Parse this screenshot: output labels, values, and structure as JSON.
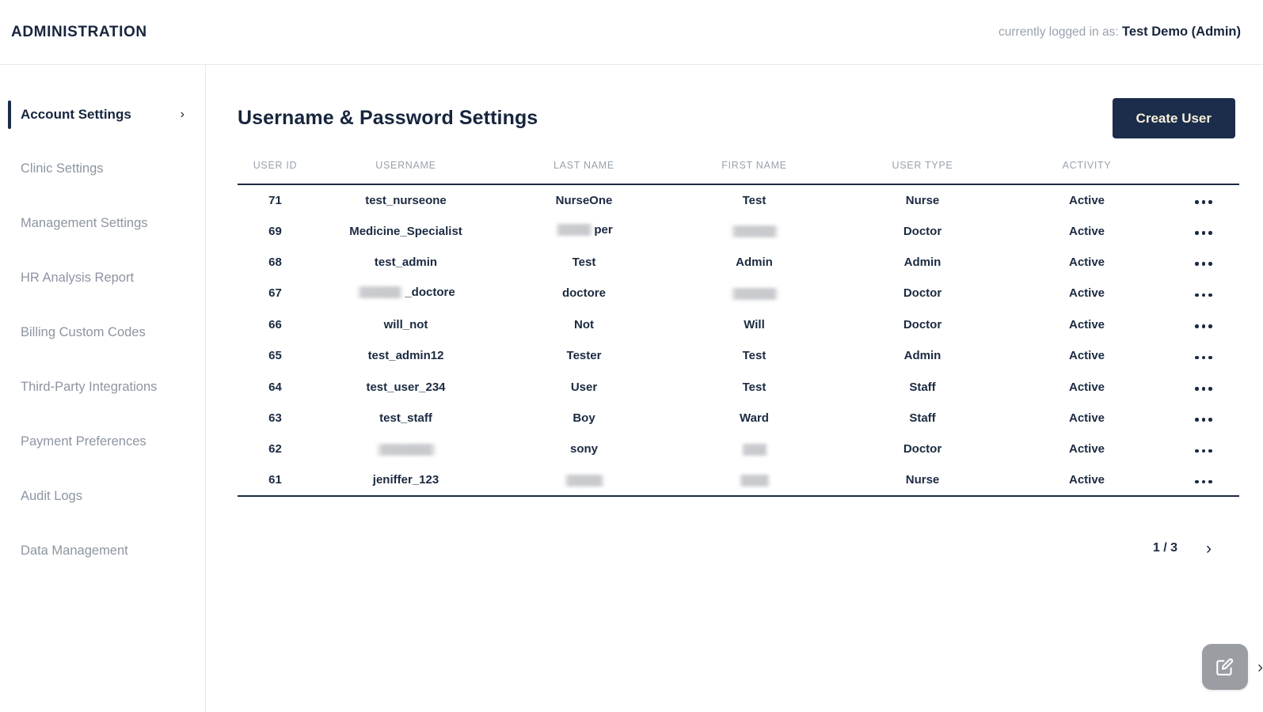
{
  "header": {
    "app_title": "ADMINISTRATION",
    "logged_in_prefix": "currently logged in as:",
    "logged_in_user": "Test Demo (Admin)"
  },
  "sidebar": {
    "items": [
      {
        "label": "Account Settings",
        "active": true,
        "chevron": "›"
      },
      {
        "label": "Clinic Settings",
        "active": false
      },
      {
        "label": "Management Settings",
        "active": false
      },
      {
        "label": "HR Analysis Report",
        "active": false
      },
      {
        "label": "Billing Custom Codes",
        "active": false
      },
      {
        "label": "Third-Party Integrations",
        "active": false
      },
      {
        "label": "Payment Preferences",
        "active": false
      },
      {
        "label": "Audit Logs",
        "active": false
      },
      {
        "label": "Data Management",
        "active": false
      }
    ]
  },
  "main": {
    "page_title": "Username & Password Settings",
    "create_user_label": "Create User",
    "table": {
      "columns": [
        "USER ID",
        "USERNAME",
        "LAST NAME",
        "FIRST NAME",
        "USER TYPE",
        "ACTIVITY"
      ],
      "rows": [
        {
          "user_id": "71",
          "username": "test_nurseone",
          "last_name": "NurseOne",
          "first_name": "Test",
          "user_type": "Nurse",
          "activity": "Active"
        },
        {
          "user_id": "69",
          "username": "Medicine_Specialist",
          "last_name": "per",
          "last_name_redacted_before": 48,
          "first_name": "",
          "first_name_redacted": 62,
          "user_type": "Doctor",
          "activity": "Active"
        },
        {
          "user_id": "68",
          "username": "test_admin",
          "last_name": "Test",
          "first_name": "Admin",
          "user_type": "Admin",
          "activity": "Active"
        },
        {
          "user_id": "67",
          "username": "_doctore",
          "username_redacted_before": 60,
          "last_name": "doctore",
          "first_name": "",
          "first_name_redacted": 62,
          "user_type": "Doctor",
          "activity": "Active"
        },
        {
          "user_id": "66",
          "username": "will_not",
          "last_name": "Not",
          "first_name": "Will",
          "user_type": "Doctor",
          "activity": "Active"
        },
        {
          "user_id": "65",
          "username": "test_admin12",
          "last_name": "Tester",
          "first_name": "Test",
          "user_type": "Admin",
          "activity": "Active"
        },
        {
          "user_id": "64",
          "username": "test_user_234",
          "last_name": "User",
          "first_name": "Test",
          "user_type": "Staff",
          "activity": "Active"
        },
        {
          "user_id": "63",
          "username": "test_staff",
          "last_name": "Boy",
          "first_name": "Ward",
          "user_type": "Staff",
          "activity": "Active"
        },
        {
          "user_id": "62",
          "username": "",
          "username_redacted": 78,
          "last_name": "sony",
          "first_name": "",
          "first_name_redacted": 34,
          "user_type": "Doctor",
          "activity": "Active"
        },
        {
          "user_id": "61",
          "username": "jeniffer_123",
          "last_name": "",
          "last_name_redacted": 52,
          "first_name": "",
          "first_name_redacted": 40,
          "user_type": "Nurse",
          "activity": "Active"
        }
      ],
      "row_menu_icon": "more-horizontal-icon"
    },
    "pagination": {
      "page_indicator": "1 / 3",
      "next_icon": "›"
    },
    "fab": {
      "icon": "edit-square-icon",
      "chevron": "›"
    }
  },
  "colors": {
    "navy": "#1b2d4a",
    "cream": "#f7eedc",
    "muted": "#9aa2ad",
    "fab_gray": "#9a9ea3"
  }
}
